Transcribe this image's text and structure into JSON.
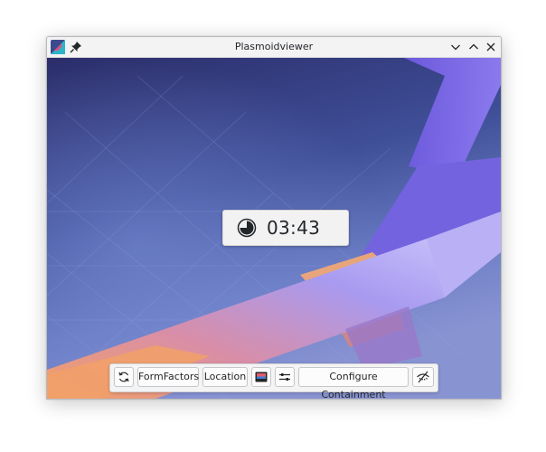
{
  "window": {
    "title": "Plasmoidviewer"
  },
  "titlebar_icons": {
    "app": "plasmoidviewer-app-icon",
    "pin": "pin-icon",
    "minimize": "chevron-down-icon",
    "maximize": "chevron-up-icon",
    "close": "close-icon"
  },
  "clock": {
    "time": "03:43",
    "icon": "timer-icon"
  },
  "toolbar": {
    "refresh_icon": "refresh-icon",
    "formfactors_label": "FormFactors",
    "location_label": "Location",
    "wallpaper_icon": "wallpaper-icon",
    "configure_icon": "configure-sliders-icon",
    "containment_label": "Configure Containment",
    "hide_icon": "hide-icon"
  },
  "colors": {
    "wallpaper_top": "#2d2f6e",
    "wallpaper_mid": "#5a6cb6",
    "wallpaper_orange": "#e59460",
    "accent_purple": "#8f7bf0"
  }
}
